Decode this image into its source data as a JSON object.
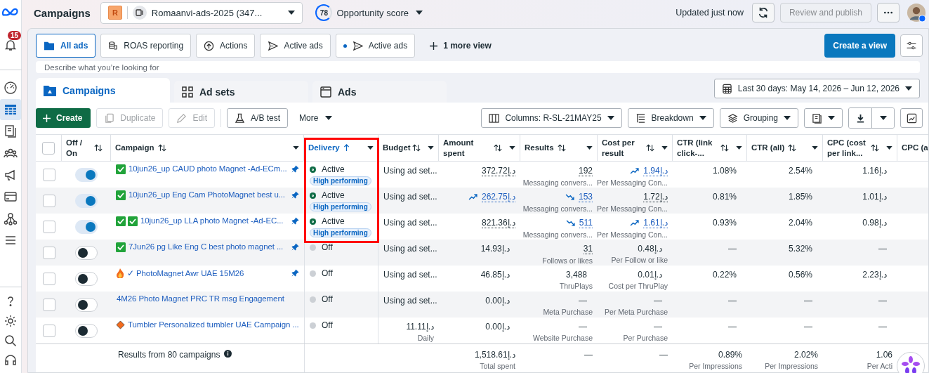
{
  "sidebar": {
    "notifications": "15",
    "items": [
      {
        "selected": false
      },
      {
        "selected": true
      },
      {
        "selected": false
      },
      {
        "selected": false
      },
      {
        "selected": false
      },
      {
        "selected": false
      },
      {
        "selected": false
      },
      {
        "selected": false
      }
    ]
  },
  "header": {
    "title": "Campaigns",
    "account": {
      "initial": "R",
      "name": "Romaanvi-ads-2025 (347..."
    },
    "score": {
      "value": "78",
      "label": "Opportunity score"
    },
    "updated": "Updated just now",
    "publish": {
      "label": "Review and publish",
      "disabled": true
    }
  },
  "views": [
    {
      "label": "All ads",
      "selected": true
    },
    {
      "label": "ROAS reporting",
      "selected": false
    },
    {
      "label": "Actions",
      "selected": false
    },
    {
      "label": "Active ads",
      "selected": false
    },
    {
      "label": "Active ads",
      "selected": false
    }
  ],
  "more_views": "1 more view",
  "create_view": "Create a view",
  "search": {
    "placeholder": "Describe what you’re looking for"
  },
  "level_tabs": [
    {
      "label": "Campaigns",
      "selected": true
    },
    {
      "label": "Ad sets",
      "selected": false
    },
    {
      "label": "Ads",
      "selected": false
    }
  ],
  "date_range": "Last 30 days: May 14, 2026 – Jun 12, 2026",
  "toolbar": {
    "create": "Create",
    "duplicate": {
      "label": "Duplicate",
      "disabled": true
    },
    "edit": {
      "label": "Edit",
      "disabled": true
    },
    "ab_test": "A/B test",
    "more": "More",
    "columns": "Columns: R-SL-21MAY25",
    "breakdown": "Breakdown",
    "grouping": "Grouping"
  },
  "table": {
    "select_all": {
      "checked": false
    },
    "columns": [
      {
        "label": "Off / On",
        "sorted": false,
        "highlighted": false
      },
      {
        "label": "Campaign",
        "sorted": false,
        "highlighted": false
      },
      {
        "label": "Delivery",
        "sorted": true,
        "highlighted": true
      },
      {
        "label": "Budget",
        "sorted": false,
        "highlighted": false
      },
      {
        "label": "Amount spent",
        "sorted": false,
        "highlighted": false
      },
      {
        "label": "Results",
        "sorted": false,
        "highlighted": false
      },
      {
        "label": "Cost per result",
        "sorted": false,
        "highlighted": false
      },
      {
        "label": "CTR (link click-...",
        "sorted": false,
        "highlighted": false
      },
      {
        "label": "CTR (all)",
        "sorted": false,
        "highlighted": false
      },
      {
        "label": "CPC (cost per link...",
        "sorted": false,
        "highlighted": false
      },
      {
        "label": "CPC (a",
        "sorted": false,
        "highlighted": false
      }
    ],
    "rows": [
      {
        "checked": false,
        "on": true,
        "markers": [
          {
            "kind": "check"
          }
        ],
        "name": "10jun26_up CAUD photo Magnet -Ad-ECm...",
        "pinned": true,
        "delivery": {
          "status": "Active",
          "active": true,
          "badge": "High performing"
        },
        "budget": {
          "kind": "text",
          "text": "Using ad set..."
        },
        "metrics": [
          {
            "text": "372.72د.إ",
            "kind": "dotted"
          },
          {
            "text": "192",
            "kind": "dotted",
            "sub": "Messaging convers..."
          },
          {
            "text": "1.94د.إ",
            "kind": "link",
            "trend": {
              "kind": "up"
            },
            "sub": "Per Messaging Con..."
          },
          {
            "text": "1.08%",
            "kind": "plain"
          },
          {
            "text": "2.54%",
            "kind": "plain"
          },
          {
            "text": "1.16د.إ",
            "kind": "plain"
          }
        ]
      },
      {
        "checked": false,
        "on": true,
        "markers": [
          {
            "kind": "check"
          }
        ],
        "name": "10jun26_up Eng Cam PhotoMagnet best u...",
        "pinned": true,
        "delivery": {
          "status": "Active",
          "active": true,
          "badge": "High performing"
        },
        "budget": {
          "kind": "text",
          "text": "Using ad set..."
        },
        "metrics": [
          {
            "text": "262.75د.إ",
            "kind": "link",
            "trend": {
              "kind": "up"
            }
          },
          {
            "text": "153",
            "kind": "link",
            "trend": {
              "kind": "down"
            },
            "sub": "Messaging convers..."
          },
          {
            "text": "1.72د.إ",
            "kind": "dotted",
            "sub": "Per Messaging Con..."
          },
          {
            "text": "0.81%",
            "kind": "plain"
          },
          {
            "text": "1.85%",
            "kind": "plain"
          },
          {
            "text": "1.01د.إ",
            "kind": "plain"
          }
        ]
      },
      {
        "checked": false,
        "on": true,
        "markers": [
          {
            "kind": "check"
          },
          {
            "kind": "check"
          }
        ],
        "name": "10jun26_up LLA photo Magnet -Ad-EC...",
        "pinned": true,
        "delivery": {
          "status": "Active",
          "active": true,
          "badge": "High performing"
        },
        "budget": {
          "kind": "text",
          "text": "Using ad set..."
        },
        "metrics": [
          {
            "text": "821.36د.إ",
            "kind": "dotted"
          },
          {
            "text": "511",
            "kind": "link",
            "trend": {
              "kind": "down"
            },
            "sub": "Messaging convers..."
          },
          {
            "text": "1.61د.إ",
            "kind": "link",
            "trend": {
              "kind": "up"
            },
            "sub": "Per Messaging Con..."
          },
          {
            "text": "0.93%",
            "kind": "plain"
          },
          {
            "text": "2.04%",
            "kind": "plain"
          },
          {
            "text": "0.98د.إ",
            "kind": "plain"
          }
        ]
      },
      {
        "checked": false,
        "on": false,
        "markers": [
          {
            "kind": "check"
          }
        ],
        "name": "7Jun26 pg Like Eng C best photo magnet ...",
        "pinned": true,
        "delivery": {
          "status": "Off",
          "active": false
        },
        "budget": {
          "kind": "text",
          "text": "Using ad set..."
        },
        "metrics": [
          {
            "text": "14.93د.إ",
            "kind": "plain"
          },
          {
            "text": "31",
            "kind": "dotted",
            "sub": "Follows or likes"
          },
          {
            "text": "0.48د.إ",
            "kind": "plain",
            "sub": "Per Follow or like"
          },
          {
            "text": "—",
            "kind": "plain"
          },
          {
            "text": "5.32%",
            "kind": "plain"
          },
          {
            "text": "—",
            "kind": "plain"
          }
        ]
      },
      {
        "checked": false,
        "on": false,
        "markers": [
          {
            "kind": "fire"
          }
        ],
        "name": "✓ PhotoMagnet Awr UAE 15M26",
        "pinned": true,
        "delivery": {
          "status": "Off",
          "active": false
        },
        "budget": {
          "kind": "text",
          "text": "Using ad set..."
        },
        "metrics": [
          {
            "text": "46.85د.إ",
            "kind": "plain"
          },
          {
            "text": "3,488",
            "kind": "plain",
            "sub": "ThruPlays"
          },
          {
            "text": "0.01د.إ",
            "kind": "plain",
            "sub": "Cost per ThruPlay"
          },
          {
            "text": "0.22%",
            "kind": "plain"
          },
          {
            "text": "0.56%",
            "kind": "plain"
          },
          {
            "text": "2.23د.إ",
            "kind": "plain"
          }
        ]
      },
      {
        "checked": false,
        "on": false,
        "markers": [],
        "name": "4M26 Photo Magnet PRC TR msg Engagement",
        "pinned": false,
        "delivery": {
          "status": "Off",
          "active": false
        },
        "budget": {
          "kind": "text",
          "text": "Using ad set..."
        },
        "metrics": [
          {
            "text": "0.00د.إ",
            "kind": "plain"
          },
          {
            "text": "—",
            "kind": "plain",
            "sub": "Meta Purchase"
          },
          {
            "text": "—",
            "kind": "plain",
            "sub": "Per Meta Purchase"
          },
          {
            "text": "—",
            "kind": "plain"
          },
          {
            "text": "—",
            "kind": "plain"
          },
          {
            "text": "—",
            "kind": "plain"
          }
        ]
      },
      {
        "checked": false,
        "on": false,
        "markers": [
          {
            "kind": "diamond"
          }
        ],
        "name": "Tumbler Personalized tumbler UAE Campaign ...",
        "pinned": false,
        "delivery": {
          "status": "Off",
          "active": false
        },
        "budget": {
          "kind": "amount",
          "text": "11.11د.إ",
          "sub": "Daily"
        },
        "metrics": [
          {
            "text": "0.00د.إ",
            "kind": "plain"
          },
          {
            "text": "—",
            "kind": "plain",
            "sub": "Website Purchase"
          },
          {
            "text": "—",
            "kind": "plain",
            "sub": "Per Purchase"
          },
          {
            "text": "—",
            "kind": "plain"
          },
          {
            "text": "—",
            "kind": "plain"
          },
          {
            "text": "—",
            "kind": "plain"
          }
        ]
      }
    ],
    "footer": {
      "label": "Results from 80 campaigns",
      "metrics": [
        {
          "text": "1,518.61د.إ",
          "sub": "Total spent"
        },
        {
          "text": "—"
        },
        {
          "text": "—"
        },
        {
          "text": "0.89%",
          "sub": "Per Impressions"
        },
        {
          "text": "2.02%",
          "sub": "Per Impressions"
        },
        {
          "text": "1.06",
          "sub": "Per Acti"
        }
      ]
    }
  }
}
